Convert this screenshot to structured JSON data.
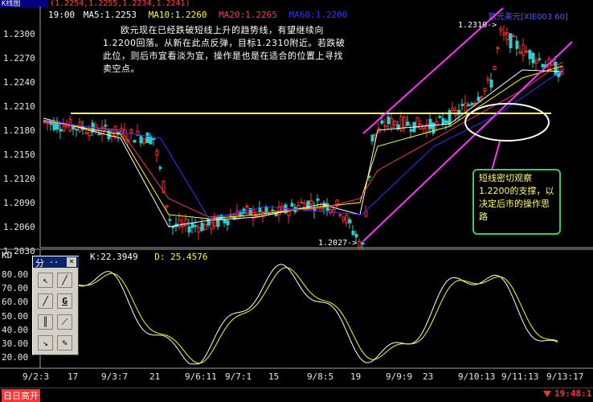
{
  "window": {
    "title_fragment": "K线图",
    "instrument_top_right": "欧元美元[XIE003 60]"
  },
  "ohlc_readout": "(1.2254,1.2255,1.2234,1.2241)",
  "ma_bar": {
    "time": "19:00",
    "ma5": "MA5:1.2253",
    "ma10": "MA10:1.2260",
    "ma20": "MA20:1.2265",
    "ma60": "MA60:1.2200",
    "colors": {
      "ma5": "#ffffff",
      "ma10": "#ffff00",
      "ma20": "#ff3366",
      "ma60": "#3333ff"
    }
  },
  "price_axis": [
    "1.2300",
    "1.2270",
    "1.2240",
    "1.2210",
    "1.2180",
    "1.2150",
    "1.2120",
    "1.2090",
    "1.2060",
    "1.2030"
  ],
  "annotation_main": "欧元现在已经跌破短线上升的趋势线，有望继续向1.2200回落。从新在此点反弹，目标1.2310附近。若跌破此位，则后市宜看淡为宜，操作是也是在适合的位置上寻找卖空点。",
  "annotation_box": "短线密切观察1.2200的支撑，以决定后市的操作思路",
  "price_markers": {
    "low": "1.2027->",
    "high": "1.2310->"
  },
  "kd_header": {
    "label": "KD",
    "k": "K:22.3949",
    "d": "D: 25.4576"
  },
  "kd_axis": [
    "80.00",
    "70.00",
    "60.00",
    "50.00",
    "40.00",
    "30.00",
    "20.00"
  ],
  "date_axis": [
    "9/2:3",
    "17",
    "9/3:7",
    "21",
    "9/6:11",
    "9/7:1",
    "15",
    "9/8:5",
    "19",
    "9/9:9",
    "23",
    "9/10:13",
    "9/11:13",
    "9/13:17"
  ],
  "status_bar": {
    "left": "日日高开",
    "time": "19:48:1"
  },
  "toolbox": {
    "title": "分",
    "close": "×",
    "tools": [
      "pointer-arrow",
      "line-tool",
      "line-tool-2",
      "G",
      "fan-lines",
      "channel-tool",
      "arrow-tool",
      "eraser-tool"
    ]
  },
  "colors": {
    "support_line": "#ffff66",
    "channel": "#ff33ff",
    "k_line": "#ffffff",
    "d_line": "#ffff00",
    "bull_candle": "#ff3333",
    "bear_candle": "#33cccc"
  },
  "chart_data": {
    "type": "line",
    "title": "",
    "series": [
      {
        "name": "MA5",
        "values": [
          1.2195,
          1.217,
          1.206,
          1.2068,
          1.2072,
          1.2088,
          1.2075,
          1.218,
          1.2188,
          1.2255,
          1.2253
        ]
      },
      {
        "name": "MA10",
        "values": [
          1.2192,
          1.2175,
          1.2075,
          1.207,
          1.2075,
          1.2085,
          1.209,
          1.216,
          1.2185,
          1.2245,
          1.226
        ]
      },
      {
        "name": "MA20",
        "values": [
          1.219,
          1.218,
          1.2095,
          1.2072,
          1.2078,
          1.2083,
          1.2095,
          1.213,
          1.218,
          1.223,
          1.2265
        ]
      }
    ],
    "ylim": [
      1.203,
      1.23
    ],
    "support_level": 1.22
  }
}
